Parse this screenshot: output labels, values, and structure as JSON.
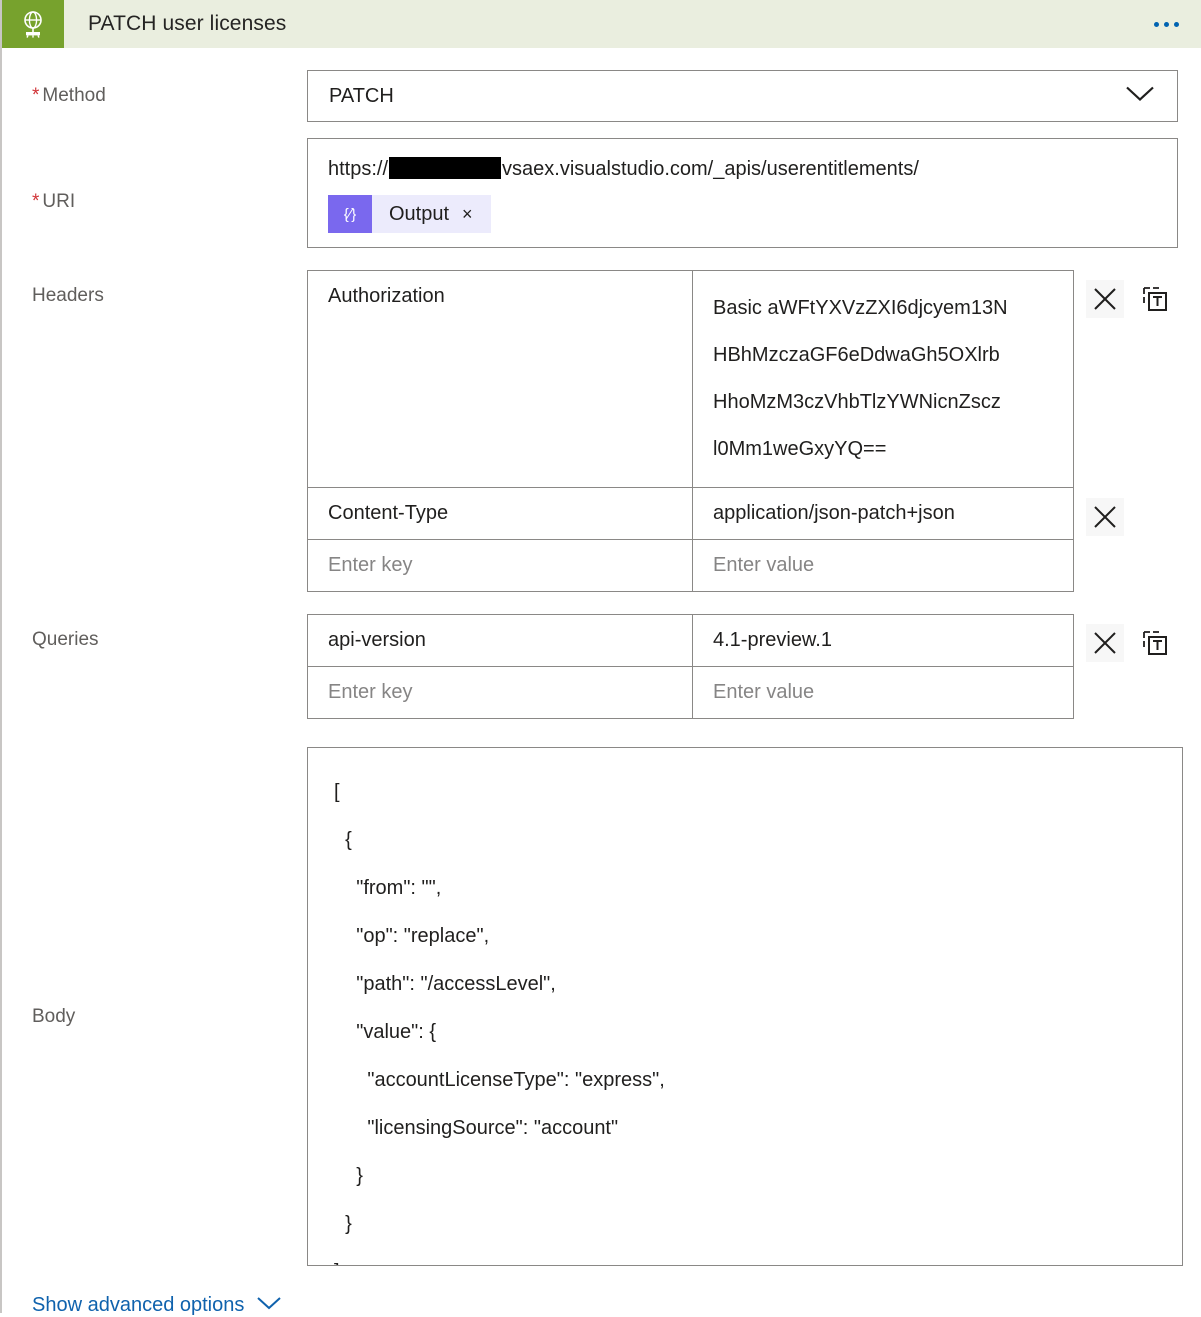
{
  "header": {
    "icon": "globe-network-icon",
    "title": "PATCH user licenses",
    "overflow_menu": "more-options-icon",
    "icon_bg_color": "#77a22d",
    "bar_bg_color": "#eaeedf",
    "menu_dot_color": "#0063b1"
  },
  "fields": {
    "method": {
      "label": "Method",
      "required_marker": "*",
      "value": "PATCH",
      "chevron": "chevron-down-icon"
    },
    "uri": {
      "label": "URI",
      "required_marker": "*",
      "prefix": "https://",
      "redacted": "",
      "suffix": "vsaex.visualstudio.com/_apis/userentitlements/",
      "token": {
        "icon_glyph": "{⁄}",
        "label": "Output",
        "remove": "×",
        "icon_color": "#7a68ee",
        "chip_color": "#ecebfc"
      }
    },
    "headers": {
      "label": "Headers",
      "rows": [
        {
          "key": "Authorization",
          "value_lines": [
            "Basic aWFtYXVzZXI6djcyem13N",
            "HBhMzczaGF6eDdwaGh5OXlrb",
            "HhoMzM3czVhbTlzYWNicnZscz",
            "l0Mm1weGxyYQ=="
          ],
          "actions": [
            "close-icon",
            "switch-to-text-mode-icon"
          ]
        },
        {
          "key": "Content-Type",
          "value_lines": [
            "application/json-patch+json"
          ],
          "actions": [
            "close-icon"
          ]
        }
      ],
      "empty_row": {
        "key_placeholder": "Enter key",
        "value_placeholder": "Enter value"
      }
    },
    "queries": {
      "label": "Queries",
      "rows": [
        {
          "key": "api-version",
          "value_lines": [
            "4.1-preview.1"
          ],
          "actions": [
            "close-icon",
            "switch-to-text-mode-icon"
          ]
        }
      ],
      "empty_row": {
        "key_placeholder": "Enter key",
        "value_placeholder": "Enter value"
      }
    },
    "body": {
      "label": "Body",
      "lines": [
        "[",
        "  {",
        "    \"from\": \"\",",
        "    \"op\": \"replace\",",
        "    \"path\": \"/accessLevel\",",
        "    \"value\": {",
        "      \"accountLicenseType\": \"express\",",
        "      \"licensingSource\": \"account\"",
        "    }",
        "  }",
        "]"
      ]
    }
  },
  "footer": {
    "advanced_options_label": "Show advanced options",
    "chevron": "chevron-down-icon",
    "link_color": "#0f62ad"
  }
}
